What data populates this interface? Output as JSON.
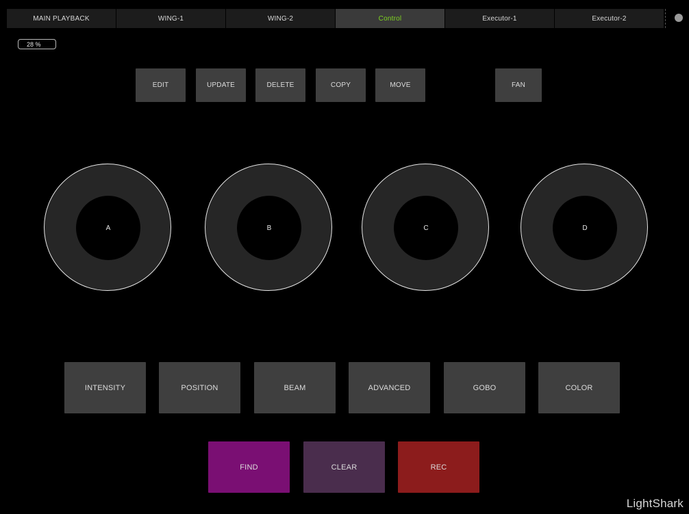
{
  "tabs": [
    {
      "label": "MAIN PLAYBACK",
      "active": false
    },
    {
      "label": "WING-1",
      "active": false
    },
    {
      "label": "WING-2",
      "active": false
    },
    {
      "label": "Control",
      "active": true
    },
    {
      "label": "Executor-1",
      "active": false
    },
    {
      "label": "Executor-2",
      "active": false
    }
  ],
  "percent": "28 %",
  "top_buttons": {
    "edit": "EDIT",
    "update": "UPDATE",
    "delete": "DELETE",
    "copy": "COPY",
    "move": "MOVE",
    "fan": "FAN"
  },
  "encoders": [
    "A",
    "B",
    "C",
    "D"
  ],
  "categories": {
    "intensity": "INTENSITY",
    "position": "POSITION",
    "beam": "BEAM",
    "advanced": "ADVANCED",
    "gobo": "GOBO",
    "color": "COLOR"
  },
  "actions": {
    "find": "FIND",
    "clear": "CLEAR",
    "rec": "REC"
  },
  "colors": {
    "active_tab_text": "#7ed321",
    "find": "#7a0f73",
    "clear": "#4a2d4d",
    "rec": "#8c1c1c"
  },
  "brand": "LightShark"
}
